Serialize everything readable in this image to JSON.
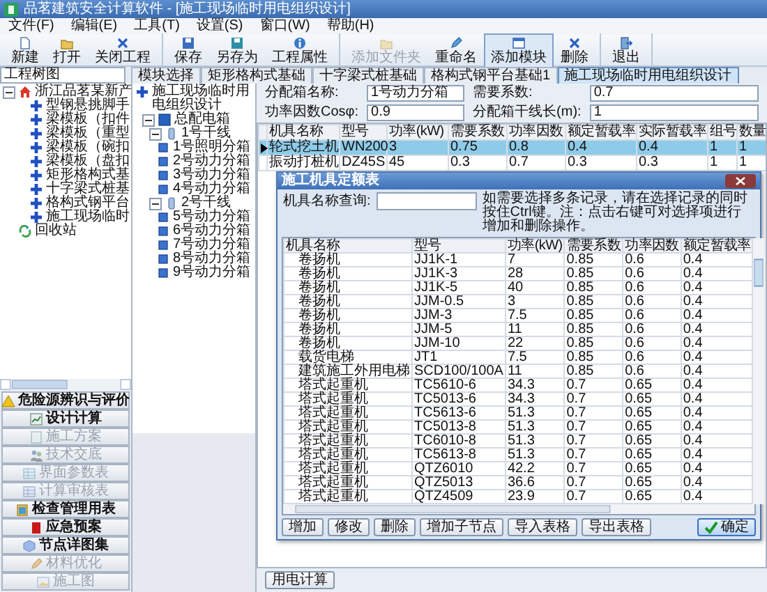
{
  "window": {
    "title": "品茗建筑安全计算软件 - [施工现场临时用电组织设计]"
  },
  "menu": [
    "文件(F)",
    "编辑(E)",
    "工具(T)",
    "设置(S)",
    "窗口(W)",
    "帮助(H)"
  ],
  "toolbar": [
    [
      {
        "label": "新建",
        "disabled": false,
        "selected": false
      },
      {
        "label": "打开",
        "disabled": false,
        "selected": false
      },
      {
        "label": "关闭工程",
        "disabled": false,
        "selected": false
      }
    ],
    [
      {
        "label": "保存",
        "disabled": false,
        "selected": false
      },
      {
        "label": "另存为",
        "disabled": false,
        "selected": false
      },
      {
        "label": "工程属性",
        "disabled": false,
        "selected": false
      }
    ],
    [
      {
        "label": "添加文件夹",
        "disabled": true,
        "selected": false
      },
      {
        "label": "重命名",
        "disabled": false,
        "selected": false
      },
      {
        "label": "添加模块",
        "disabled": false,
        "selected": true
      },
      {
        "label": "删除",
        "disabled": false,
        "selected": false
      }
    ],
    [
      {
        "label": "退出",
        "disabled": false,
        "selected": false
      }
    ]
  ],
  "project_tree": {
    "title": "工程树图",
    "items": [
      {
        "kind": "project",
        "label": "浙江品茗某新产",
        "expanded": true,
        "children": [
          {
            "kind": "module",
            "label": "型钢悬挑脚手"
          },
          {
            "kind": "module",
            "label": "梁模板（扣件"
          },
          {
            "kind": "module",
            "label": "梁模板（重型"
          },
          {
            "kind": "module",
            "label": "梁模板（碗扣"
          },
          {
            "kind": "module",
            "label": "梁模板（盘扣"
          },
          {
            "kind": "module",
            "label": "矩形格构式基"
          },
          {
            "kind": "module",
            "label": "十字梁式桩基"
          },
          {
            "kind": "module",
            "label": "格构式钢平台"
          },
          {
            "kind": "module",
            "label": "施工现场临时"
          }
        ]
      },
      {
        "kind": "recycle",
        "label": "回收站"
      }
    ]
  },
  "module_buttons": [
    {
      "label": "危险源辨识与评价",
      "disabled": false
    },
    {
      "label": "设计计算",
      "disabled": false
    },
    {
      "label": "施工方案",
      "disabled": true
    },
    {
      "label": "技术交底",
      "disabled": true
    },
    {
      "label": "界面参数表",
      "disabled": true
    },
    {
      "label": "计算审核表",
      "disabled": true
    },
    {
      "label": "检查管理用表",
      "disabled": false
    },
    {
      "label": "应急预案",
      "disabled": false
    },
    {
      "label": "节点详图集",
      "disabled": false
    },
    {
      "label": "材料优化",
      "disabled": true
    },
    {
      "label": "施工图",
      "disabled": true
    }
  ],
  "tabs": [
    {
      "label": "模块选择",
      "selected": false
    },
    {
      "label": "矩形格构式基础",
      "selected": false
    },
    {
      "label": "十字梁式桩基础",
      "selected": false
    },
    {
      "label": "格构式钢平台基础1",
      "selected": false
    },
    {
      "label": "施工现场临时用电组织设计",
      "selected": true
    }
  ],
  "distribution_tree": {
    "label": "施工现场临时用电组织设计",
    "children": [
      {
        "label": "总配电箱",
        "expanded": true,
        "children": [
          {
            "label": "1号干线",
            "expanded": true,
            "children": [
              {
                "label": "1号照明分箱"
              },
              {
                "label": "2号动力分箱"
              },
              {
                "label": "3号动力分箱"
              },
              {
                "label": "4号动力分箱"
              }
            ]
          },
          {
            "label": "2号干线",
            "expanded": true,
            "children": [
              {
                "label": "5号动力分箱"
              },
              {
                "label": "6号动力分箱"
              },
              {
                "label": "7号动力分箱"
              },
              {
                "label": "8号动力分箱"
              },
              {
                "label": "9号动力分箱"
              }
            ]
          }
        ]
      }
    ]
  },
  "form": {
    "fields": [
      {
        "label": "分配箱名称:",
        "value": "1号动力分箱"
      },
      {
        "label": "需要系数:",
        "value": "0.7"
      },
      {
        "label": "功率因数Cosφ:",
        "value": "0.9"
      },
      {
        "label": "分配箱干线长(m):",
        "value": "1"
      }
    ]
  },
  "equipment_table": {
    "columns": [
      "机具名称",
      "型号",
      "功率(kW)",
      "需要系数",
      "功率因数",
      "额定暂载率",
      "实际暂载率",
      "组号",
      "数量"
    ],
    "rows": [
      {
        "selected": true,
        "cells": [
          "轮式挖土机",
          "WN200",
          "3",
          "0.75",
          "0.8",
          "0.4",
          "0.4",
          "1",
          "1"
        ]
      },
      {
        "selected": false,
        "cells": [
          "振动打桩机",
          "DZ45S",
          "45",
          "0.3",
          "0.7",
          "0.3",
          "0.3",
          "1",
          "1"
        ]
      }
    ]
  },
  "dialog": {
    "title": "施工机具定额表",
    "search_label": "机具名称查询:",
    "hint": "如需要选择多条记录，请在选择记录的同时按住Ctrl键。注：点击右键可对选择项进行增加和删除操作。",
    "columns": [
      "机具名称",
      "型号",
      "功率(kW)",
      "需要系数",
      "功率因数",
      "额定暂载率"
    ],
    "rows": [
      [
        "卷扬机",
        "JJ1K-1",
        "7",
        "0.85",
        "0.6",
        "0.4"
      ],
      [
        "卷扬机",
        "JJ1K-3",
        "28",
        "0.85",
        "0.6",
        "0.4"
      ],
      [
        "卷扬机",
        "JJ1K-5",
        "40",
        "0.85",
        "0.6",
        "0.4"
      ],
      [
        "卷扬机",
        "JJM-0.5",
        "3",
        "0.85",
        "0.6",
        "0.4"
      ],
      [
        "卷扬机",
        "JJM-3",
        "7.5",
        "0.85",
        "0.6",
        "0.4"
      ],
      [
        "卷扬机",
        "JJM-5",
        "11",
        "0.85",
        "0.6",
        "0.4"
      ],
      [
        "卷扬机",
        "JJM-10",
        "22",
        "0.85",
        "0.6",
        "0.4"
      ],
      [
        "载货电梯",
        "JT1",
        "7.5",
        "0.85",
        "0.6",
        "0.4"
      ],
      [
        "建筑施工外用电梯",
        "SCD100/100A",
        "11",
        "0.85",
        "0.6",
        "0.4"
      ],
      [
        "塔式起重机",
        "TC5610-6",
        "34.3",
        "0.7",
        "0.65",
        "0.4"
      ],
      [
        "塔式起重机",
        "TC5013-6",
        "34.3",
        "0.7",
        "0.65",
        "0.4"
      ],
      [
        "塔式起重机",
        "TC5613-6",
        "51.3",
        "0.7",
        "0.65",
        "0.4"
      ],
      [
        "塔式起重机",
        "TC5013-8",
        "51.3",
        "0.7",
        "0.65",
        "0.4"
      ],
      [
        "塔式起重机",
        "TC6010-8",
        "51.3",
        "0.7",
        "0.65",
        "0.4"
      ],
      [
        "塔式起重机",
        "TC5613-8",
        "51.3",
        "0.7",
        "0.65",
        "0.4"
      ],
      [
        "塔式起重机",
        "QTZ6010",
        "42.2",
        "0.7",
        "0.65",
        "0.4"
      ],
      [
        "塔式起重机",
        "QTZ5013",
        "36.6",
        "0.7",
        "0.65",
        "0.4"
      ],
      [
        "塔式起重机",
        "QTZ4509",
        "23.9",
        "0.7",
        "0.65",
        "0.4"
      ]
    ],
    "buttons": [
      {
        "label": "增加",
        "kind": "plain"
      },
      {
        "label": "修改",
        "kind": "plain"
      },
      {
        "label": "删除",
        "kind": "plain"
      },
      {
        "label": "增加子节点",
        "kind": "plain"
      },
      {
        "label": "导入表格",
        "kind": "plain"
      },
      {
        "label": "导出表格",
        "kind": "plain"
      },
      {
        "label": "确定",
        "kind": "confirm"
      }
    ]
  },
  "footer": {
    "button": "用电计算"
  }
}
